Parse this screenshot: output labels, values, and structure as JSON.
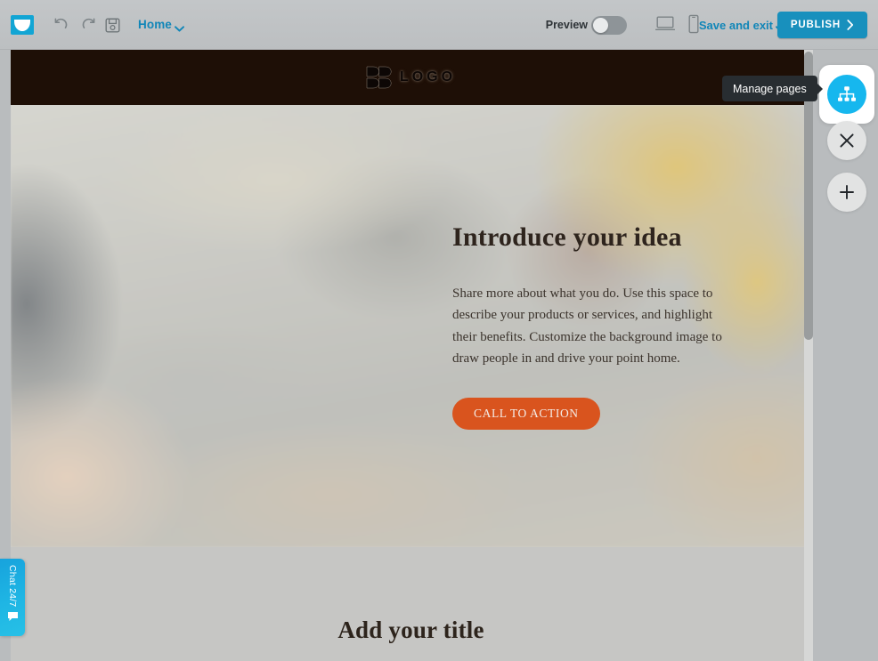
{
  "toolbar": {
    "brand_icon": "mail-envelope-icon",
    "undo_icon": "undo-arrow-icon",
    "redo_icon": "redo-arrow-icon",
    "save_icon": "floppy-disk-save-icon",
    "page_name": "Home",
    "page_caret_icon": "chevron-down-icon",
    "preview_label": "Preview",
    "preview_toggle_state": "off",
    "desktop_icon": "desktop-monitor-icon",
    "mobile_icon": "mobile-phone-icon",
    "save_and_exit_label": "Save and exit",
    "save_and_exit_caret_icon": "chevron-down-icon",
    "publish_label": "PUBLISH",
    "publish_chevron_icon": "chevron-right-icon",
    "accent_blue": "#1186b8",
    "publish_bg": "#1890bd",
    "brand_cyan": "#12a5d4"
  },
  "right_rail": {
    "manage_pages_icon": "sitemap-icon",
    "manage_pages_tooltip": "Manage pages",
    "close_icon": "close-x-icon",
    "add_icon": "plus-icon",
    "active_color": "#16b7ee"
  },
  "canvas": {
    "site_header": {
      "logo_mark_icon": "bb-logo-mark-icon",
      "logo_text": "LOGO",
      "background": "#1e0f06"
    },
    "hero": {
      "title": "Introduce your idea",
      "body": "Share more about what you do. Use this space to describe your products or services, and highlight their benefits. Customize the background image to draw people in and drive your point home.",
      "cta_label": "CALL TO ACTION",
      "cta_color": "#d9541e"
    },
    "section_two": {
      "title": "Add your title",
      "background": "#c6c6c4"
    },
    "scrollbar": {
      "orientation": "vertical",
      "thumb_position": "top"
    }
  },
  "chat_widget": {
    "label": "Chat 24/7",
    "icon": "chat-bubble-icon",
    "color": "#1fb6e4"
  }
}
